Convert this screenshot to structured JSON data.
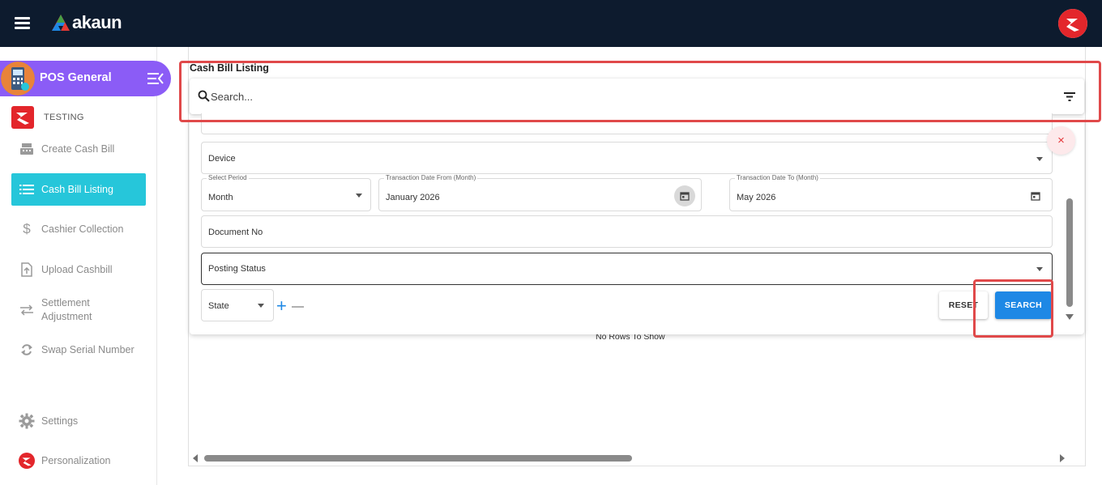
{
  "header": {
    "brand": "akaun"
  },
  "sidebar": {
    "app_title": "POS General",
    "org_name": "TESTING",
    "items": [
      {
        "label": "Create Cash Bill",
        "icon": "cash-register-icon"
      },
      {
        "label": "Cash Bill Listing",
        "icon": "list-icon",
        "active": true
      },
      {
        "label": "Cashier Collection",
        "icon": "dollar-icon"
      },
      {
        "label": "Upload Cashbill",
        "icon": "upload-file-icon"
      },
      {
        "label_line1": "Settlement",
        "label_line2": "Adjustment",
        "icon": "swap-arrows-icon"
      },
      {
        "label": "Swap Serial Number",
        "icon": "sync-icon"
      },
      {
        "label": "Settings",
        "icon": "gear-icon"
      },
      {
        "label": "Personalization",
        "icon": "org-logo-icon"
      }
    ]
  },
  "main": {
    "title": "Cash Bill Listing",
    "search_placeholder": "Search...",
    "no_rows": "No Rows To Show"
  },
  "filters": {
    "device": "Device",
    "select_period_label": "Select Period",
    "select_period_value": "Month",
    "date_from_label": "Transaction Date From (Month)",
    "date_from_value": "January 2026",
    "date_to_label": "Transaction Date To (Month)",
    "date_to_value": "May 2026",
    "document_no": "Document No",
    "posting_status": "Posting Status",
    "state": "State",
    "reset_label": "RESET",
    "search_label": "SEARCH",
    "close_symbol": "×"
  },
  "colors": {
    "topbar": "#0d1b2e",
    "app_pill": "#8b5cf6",
    "active_nav": "#26c6da",
    "search_button": "#1e88e5",
    "highlight_box": "#e0494a"
  }
}
